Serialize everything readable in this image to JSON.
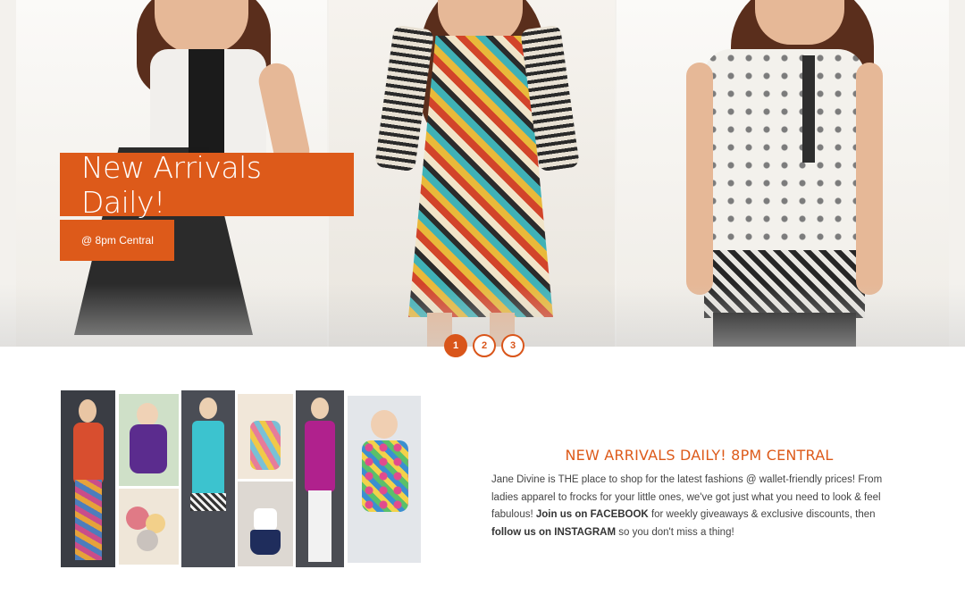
{
  "slider": {
    "caption_title": "New Arrivals Daily!",
    "caption_sub": "@ 8pm Central",
    "pager": [
      "1",
      "2",
      "3"
    ],
    "active_slide": 1,
    "accent_color": "#dd5a1a"
  },
  "info": {
    "heading": "NEW ARRIVALS DAILY! 8PM CENTRAL",
    "body_1": "Jane Divine is THE place to shop for the latest fashions @ wallet-friendly prices! From ladies apparel to frocks for your little ones, we've got just what you need to look & feel fabulous! ",
    "facebook_link": "Join us on FACEBOOK",
    "body_2": " for weekly giveaways & exclusive discounts, then ",
    "instagram_link": "follow us on INSTAGRAM",
    "body_3": " so you don't miss a thing!"
  }
}
